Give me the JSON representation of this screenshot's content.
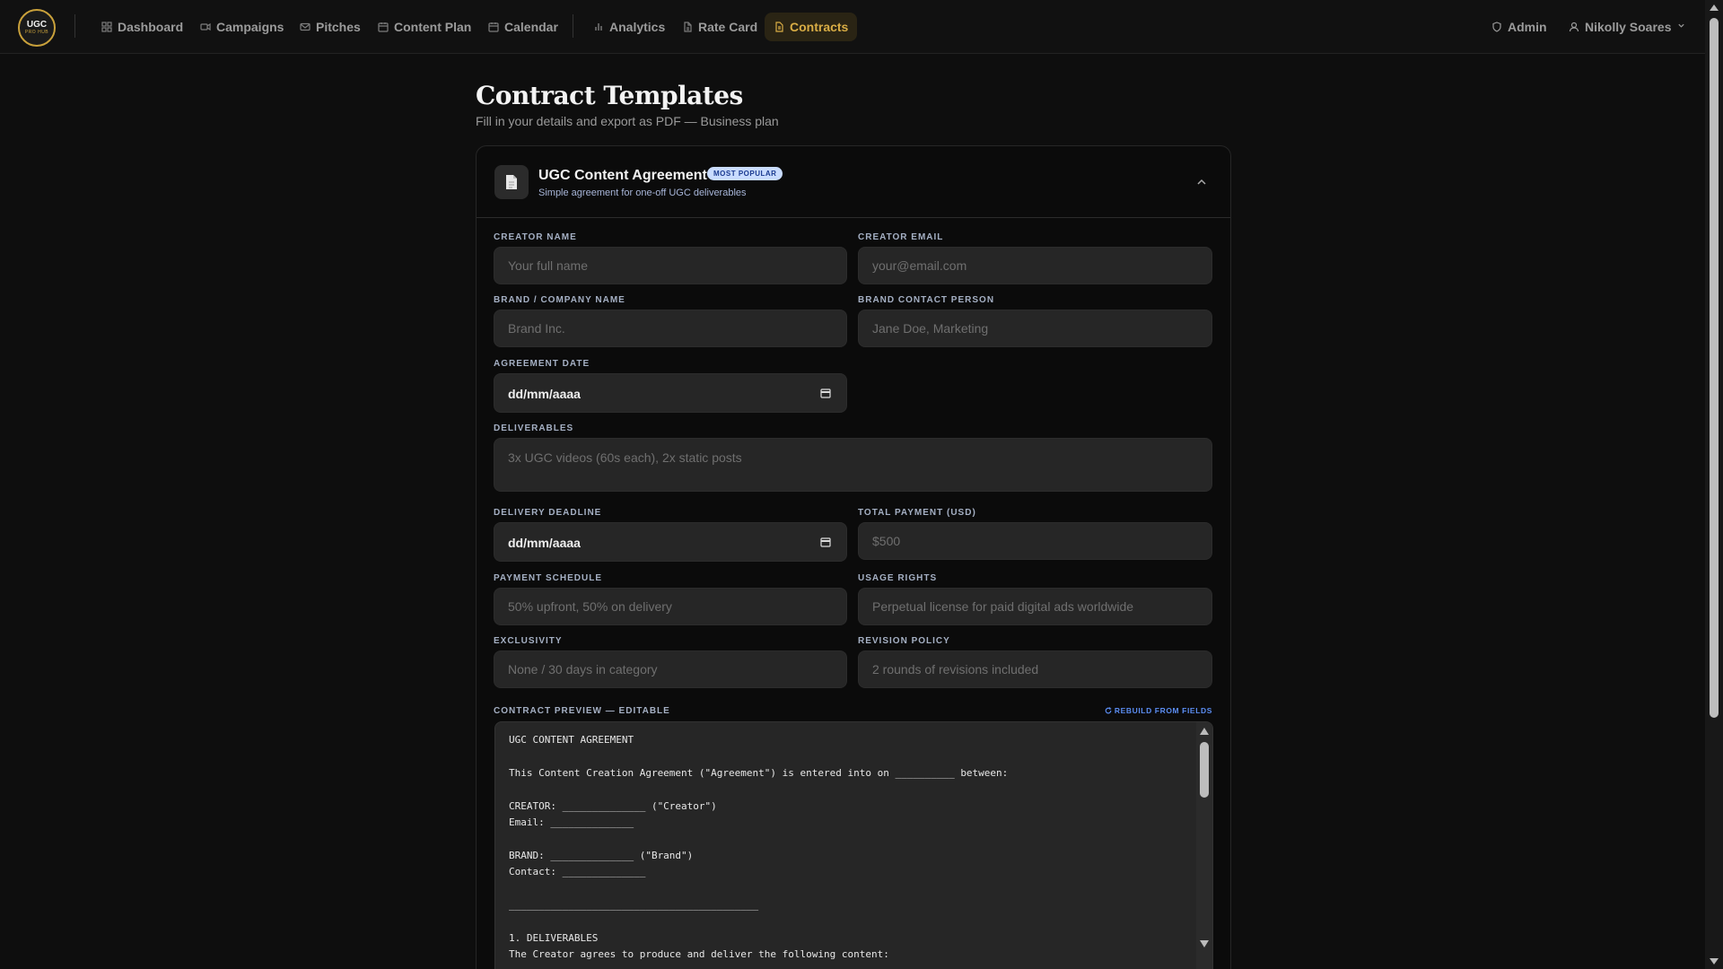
{
  "nav": {
    "logo_line1": "UGC",
    "logo_line2": "PRO HUB",
    "items": [
      {
        "label": "Dashboard",
        "icon": "grid-icon"
      },
      {
        "label": "Campaigns",
        "icon": "video-icon"
      },
      {
        "label": "Pitches",
        "icon": "mail-icon"
      },
      {
        "label": "Content Plan",
        "icon": "calendar-icon"
      },
      {
        "label": "Calendar",
        "icon": "calendar-icon"
      },
      {
        "label": "Analytics",
        "icon": "bar-chart-icon"
      },
      {
        "label": "Rate Card",
        "icon": "file-icon"
      },
      {
        "label": "Contracts",
        "icon": "contract-icon",
        "active": true
      }
    ],
    "admin_label": "Admin",
    "user_label": "Nikolly Soares"
  },
  "colors": {
    "accent": "#d9ad45",
    "background": "#0e0e0e",
    "link": "#5b8df2",
    "badge_bg": "#c9dcff"
  },
  "page": {
    "title": "Contract Templates",
    "subtitle": "Fill in your details and export as PDF — Business plan"
  },
  "card": {
    "title": "UGC Content Agreement",
    "badge": "MOST POPULAR",
    "description": "Simple agreement for one-off UGC deliverables"
  },
  "form": {
    "creator_name": {
      "label": "CREATOR NAME",
      "placeholder": "Your full name",
      "value": ""
    },
    "creator_email": {
      "label": "CREATOR EMAIL",
      "placeholder": "your@email.com",
      "value": ""
    },
    "brand_name": {
      "label": "BRAND / COMPANY NAME",
      "placeholder": "Brand Inc.",
      "value": ""
    },
    "brand_contact": {
      "label": "BRAND CONTACT PERSON",
      "placeholder": "Jane Doe, Marketing",
      "value": ""
    },
    "agreement_date": {
      "label": "AGREEMENT DATE",
      "value": "dd/mm/aaaa"
    },
    "deliverables": {
      "label": "DELIVERABLES",
      "placeholder": "3x UGC videos (60s each), 2x static posts",
      "value": ""
    },
    "delivery_deadline": {
      "label": "DELIVERY DEADLINE",
      "value": "dd/mm/aaaa"
    },
    "total_payment": {
      "label": "TOTAL PAYMENT (USD)",
      "placeholder": "$500",
      "value": ""
    },
    "payment_schedule": {
      "label": "PAYMENT SCHEDULE",
      "placeholder": "50% upfront, 50% on delivery",
      "value": ""
    },
    "usage_rights": {
      "label": "USAGE RIGHTS",
      "placeholder": "Perpetual license for paid digital ads worldwide",
      "value": ""
    },
    "exclusivity": {
      "label": "EXCLUSIVITY",
      "placeholder": "None / 30 days in category",
      "value": ""
    },
    "revision_policy": {
      "label": "REVISION POLICY",
      "placeholder": "2 rounds of revisions included",
      "value": ""
    }
  },
  "preview": {
    "label": "CONTRACT PREVIEW — EDITABLE",
    "rebuild_label": "REBUILD FROM FIELDS",
    "text": "UGC CONTENT AGREEMENT\n\nThis Content Creation Agreement (\"Agreement\") is entered into on __________ between:\n\nCREATOR: ______________ (\"Creator\")\nEmail: ______________\n\nBRAND: ______________ (\"Brand\")\nContact: ______________\n\n__________________________________________\n\n1. DELIVERABLES\nThe Creator agrees to produce and deliver the following content:"
  }
}
